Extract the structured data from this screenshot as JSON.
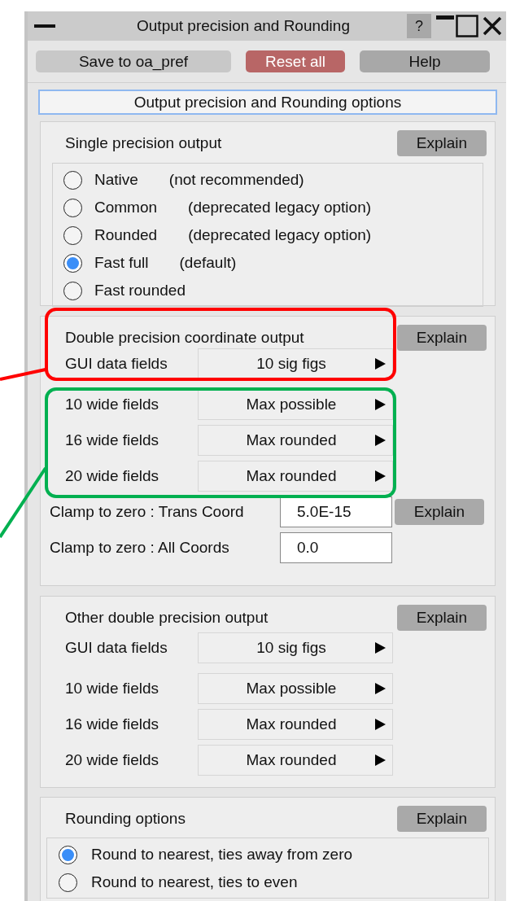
{
  "window": {
    "title": "Output precision and Rounding",
    "help_button": "?"
  },
  "toolbar": [
    {
      "label": "Save to oa_pref",
      "kind": "plain"
    },
    {
      "label": "Reset all",
      "kind": "danger"
    },
    {
      "label": "Help",
      "kind": "dark"
    }
  ],
  "heading": "Output precision and Rounding options",
  "single_precision": {
    "title": "Single precision output",
    "explain": "Explain",
    "options": [
      {
        "label": "Native",
        "note": "(not recommended)",
        "selected": false
      },
      {
        "label": "Common",
        "note": "(deprecated legacy option)",
        "selected": false
      },
      {
        "label": "Rounded",
        "note": "(deprecated legacy option)",
        "selected": false
      },
      {
        "label": "Fast full",
        "note": "(default)",
        "selected": true
      },
      {
        "label": "Fast rounded",
        "selected": false
      }
    ]
  },
  "double_coordinate": {
    "title": "Double precision coordinate output",
    "explain": "Explain",
    "fields": [
      {
        "label": "GUI data fields",
        "value": "10 sig figs"
      },
      {
        "label": "10 wide fields",
        "value": "Max possible"
      },
      {
        "label": "16 wide fields",
        "value": "Max rounded"
      },
      {
        "label": "20 wide fields",
        "value": "Max rounded"
      }
    ],
    "clamps": [
      {
        "label": "Clamp to zero : Trans Coord",
        "value": "5.0E-15",
        "explain": "Explain"
      },
      {
        "label": "Clamp to zero : All Coords",
        "value": "0.0"
      }
    ]
  },
  "other_double": {
    "title": "Other double precision output",
    "explain": "Explain",
    "fields": [
      {
        "label": "GUI data fields",
        "value": "10 sig figs"
      },
      {
        "label": "10 wide fields",
        "value": "Max possible"
      },
      {
        "label": "16 wide fields",
        "value": "Max rounded"
      },
      {
        "label": "20 wide fields",
        "value": "Max rounded"
      }
    ]
  },
  "rounding": {
    "title": "Rounding options",
    "explain": "Explain",
    "options": [
      {
        "label": "Round to nearest, ties away from zero",
        "selected": true
      },
      {
        "label": "Round to nearest, ties to even",
        "selected": false
      }
    ]
  },
  "annotations": [
    {
      "color": "#ff0000"
    },
    {
      "color": "#00b050"
    }
  ]
}
